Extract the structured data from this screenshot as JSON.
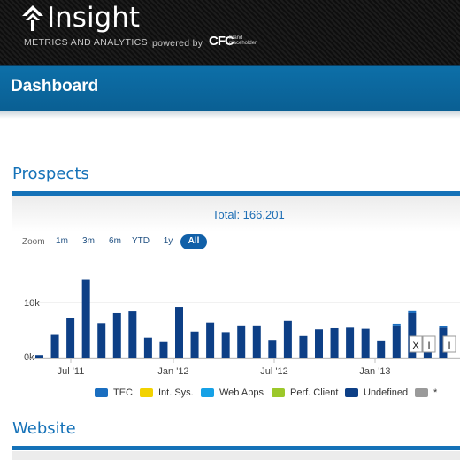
{
  "header": {
    "brand": "Insight",
    "tagline": "METRICS AND ANALYTICS",
    "powered": "powered by",
    "partner_logo": "CFC",
    "partner_sub": "brand placeholder"
  },
  "page_title": "Dashboard",
  "sections": {
    "prospects": "Prospects",
    "website": "Website"
  },
  "chart_controls": {
    "total_text": "Total: 166,201",
    "zoom_label": "Zoom",
    "zoom_options": [
      "1m",
      "3m",
      "6m",
      "YTD",
      "1y",
      "All"
    ],
    "active_zoom": "All"
  },
  "chart_data": {
    "type": "bar",
    "y_tick_labels": [
      "0k",
      "10k"
    ],
    "x_tick_labels": [
      "Jul '11",
      "Jan '12",
      "Jul '12",
      "Jan '13"
    ],
    "ylim": [
      0,
      15000
    ],
    "series": [
      {
        "name": "Undefined",
        "values": [
          600,
          4200,
          7300,
          14200,
          6300,
          8100,
          8400,
          3700,
          2900,
          9200,
          4800,
          6400,
          4700,
          5900,
          5900,
          3300,
          6700,
          4000,
          5200,
          5400,
          5500,
          5300,
          3200,
          5900,
          8100,
          2200,
          5500
        ]
      },
      {
        "name": "TEC",
        "values": [
          0,
          0,
          0,
          0,
          0,
          0,
          0,
          0,
          0,
          0,
          0,
          0,
          0,
          0,
          0,
          0,
          0,
          0,
          0,
          0,
          0,
          0,
          0,
          300,
          500,
          0,
          300
        ]
      }
    ],
    "legend": [
      {
        "name": "TEC",
        "color": "#1a6ec0"
      },
      {
        "name": "Int. Sys.",
        "color": "#f2d200"
      },
      {
        "name": "Web Apps",
        "color": "#16a1e6"
      },
      {
        "name": "Perf. Client",
        "color": "#9cc82a"
      },
      {
        "name": "Undefined",
        "color": "#0d3f86"
      },
      {
        "name": "*",
        "color": "#9a9a9a"
      }
    ],
    "markers": [
      "X",
      "I",
      "I"
    ],
    "grid": true
  }
}
